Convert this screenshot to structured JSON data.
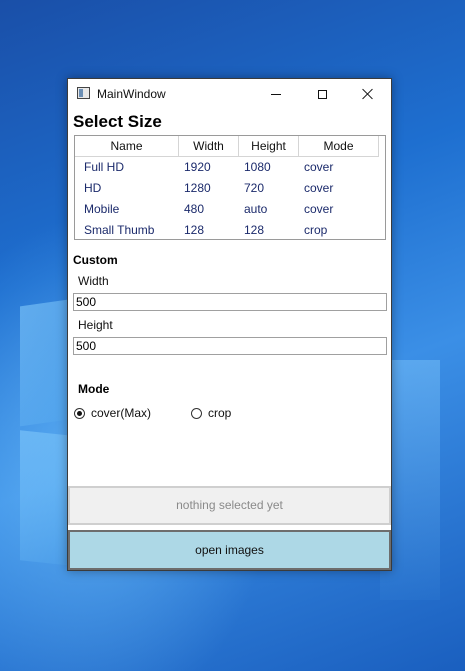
{
  "window": {
    "title": "MainWindow",
    "controls": {
      "minimize": "minimize",
      "maximize": "maximize",
      "close": "close"
    }
  },
  "heading": "Select Size",
  "table": {
    "columns": [
      "Name",
      "Width",
      "Height",
      "Mode"
    ],
    "rows": [
      {
        "name": "Full HD",
        "width": "1920",
        "height": "1080",
        "mode": "cover"
      },
      {
        "name": "HD",
        "width": "1280",
        "height": "720",
        "mode": "cover"
      },
      {
        "name": "Mobile",
        "width": "480",
        "height": "auto",
        "mode": "cover"
      },
      {
        "name": "Small Thumb",
        "width": "128",
        "height": "128",
        "mode": "crop"
      }
    ]
  },
  "custom": {
    "title": "Custom",
    "width_label": "Width",
    "width_value": "500",
    "height_label": "Height",
    "height_value": "500"
  },
  "mode": {
    "title": "Mode",
    "options": [
      {
        "label": "cover(Max)",
        "selected": true
      },
      {
        "label": "crop",
        "selected": false
      }
    ]
  },
  "status_button": "nothing selected yet",
  "open_button": "open images",
  "colors": {
    "accent": "#add8e6",
    "row_text": "#1b2a6b",
    "desktop": "#1e6fd0"
  }
}
